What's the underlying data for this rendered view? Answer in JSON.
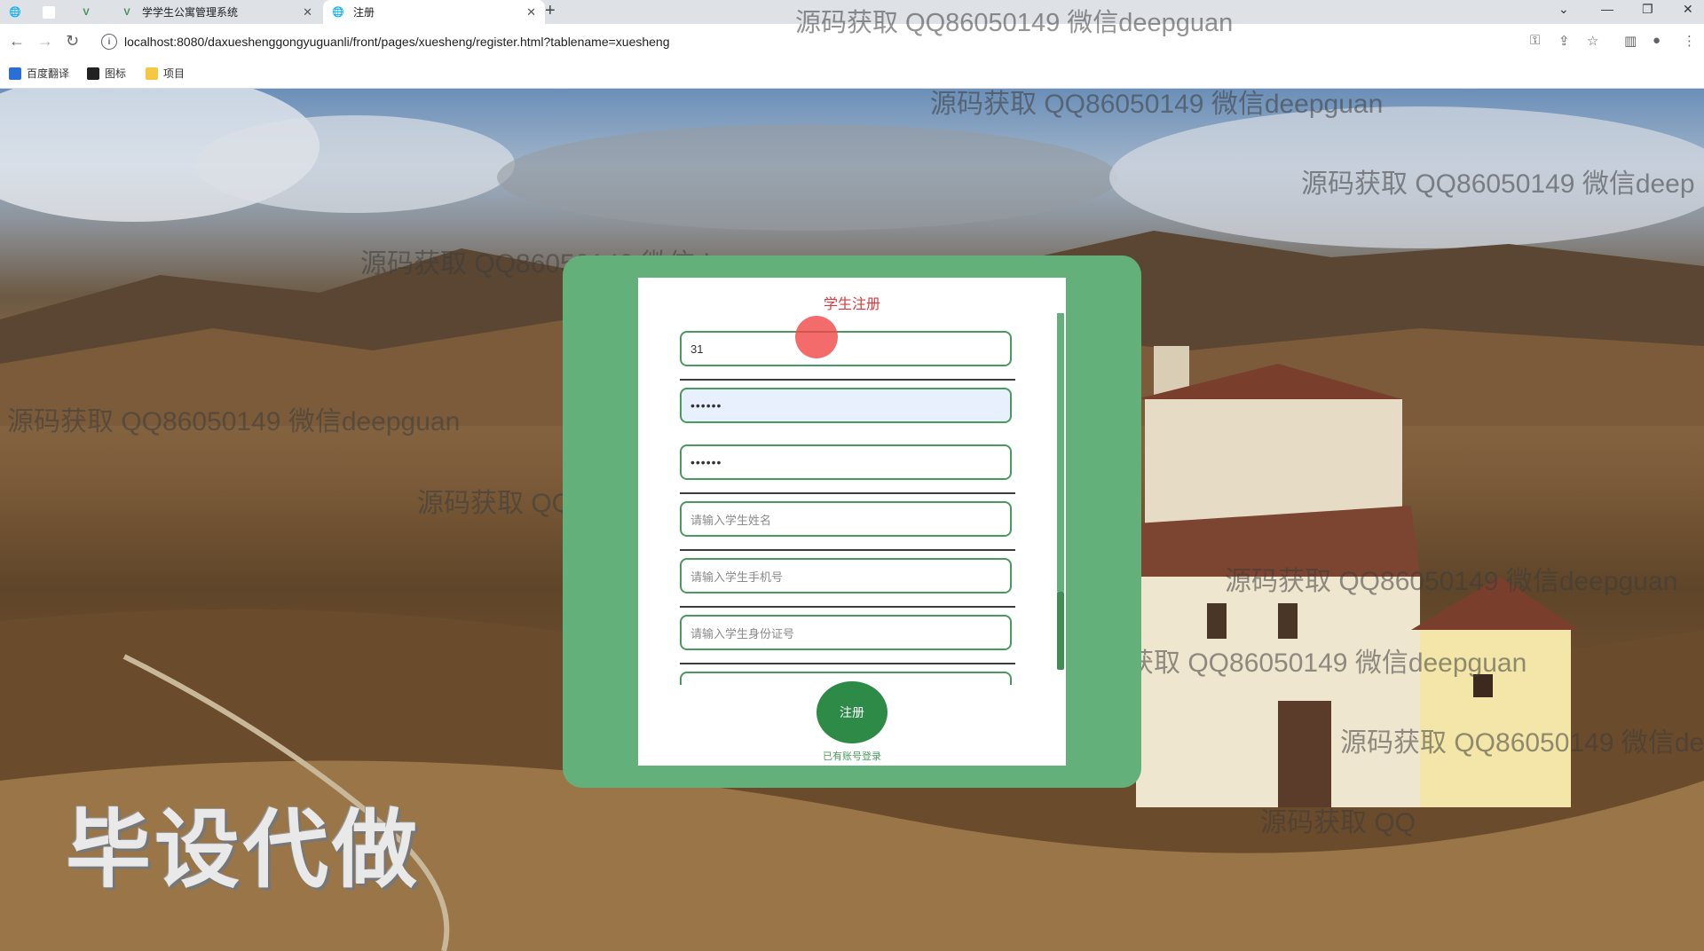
{
  "browser": {
    "tabs": [
      {
        "title": "",
        "icon": "globe-icon"
      },
      {
        "title": "",
        "icon": "blank-page-icon"
      },
      {
        "title": "",
        "icon": "vue-logo-icon"
      },
      {
        "title": "学学生公寓管理系统",
        "icon": "vue-logo-icon"
      },
      {
        "title": "注册",
        "icon": "globe-icon",
        "active": true
      }
    ],
    "url": "localhost:8080/daxueshenggongyuguanli/front/pages/xuesheng/register.html?tablename=xuesheng",
    "bookmarks": [
      {
        "label": "百度翻译",
        "icon": "translate-icon"
      },
      {
        "label": "图标",
        "icon": "image-icon"
      },
      {
        "label": "项目",
        "icon": "folder-icon"
      }
    ]
  },
  "watermarks": {
    "text": "源码获取 QQ86050149 微信deepguan",
    "partial": "源码获取 QQ86050149 微信deep",
    "partial2": "源码获取 QQ",
    "big": "毕设代做"
  },
  "form": {
    "title": "学生注册",
    "fields": [
      {
        "name": "account",
        "value": "31",
        "placeholder": ""
      },
      {
        "name": "password",
        "value": "••••••",
        "placeholder": ""
      },
      {
        "name": "confirm-password",
        "value": "••••••",
        "placeholder": ""
      },
      {
        "name": "student-name",
        "value": "",
        "placeholder": "请输入学生姓名"
      },
      {
        "name": "student-phone",
        "value": "",
        "placeholder": "请输入学生手机号"
      },
      {
        "name": "student-id-card",
        "value": "",
        "placeholder": "请输入学生身份证号"
      }
    ],
    "submit_label": "注册",
    "login_link": "已有账号登录"
  },
  "colors": {
    "card_green": "#64b07a",
    "button_green": "#2e8b47",
    "title_red": "#d9393a"
  }
}
